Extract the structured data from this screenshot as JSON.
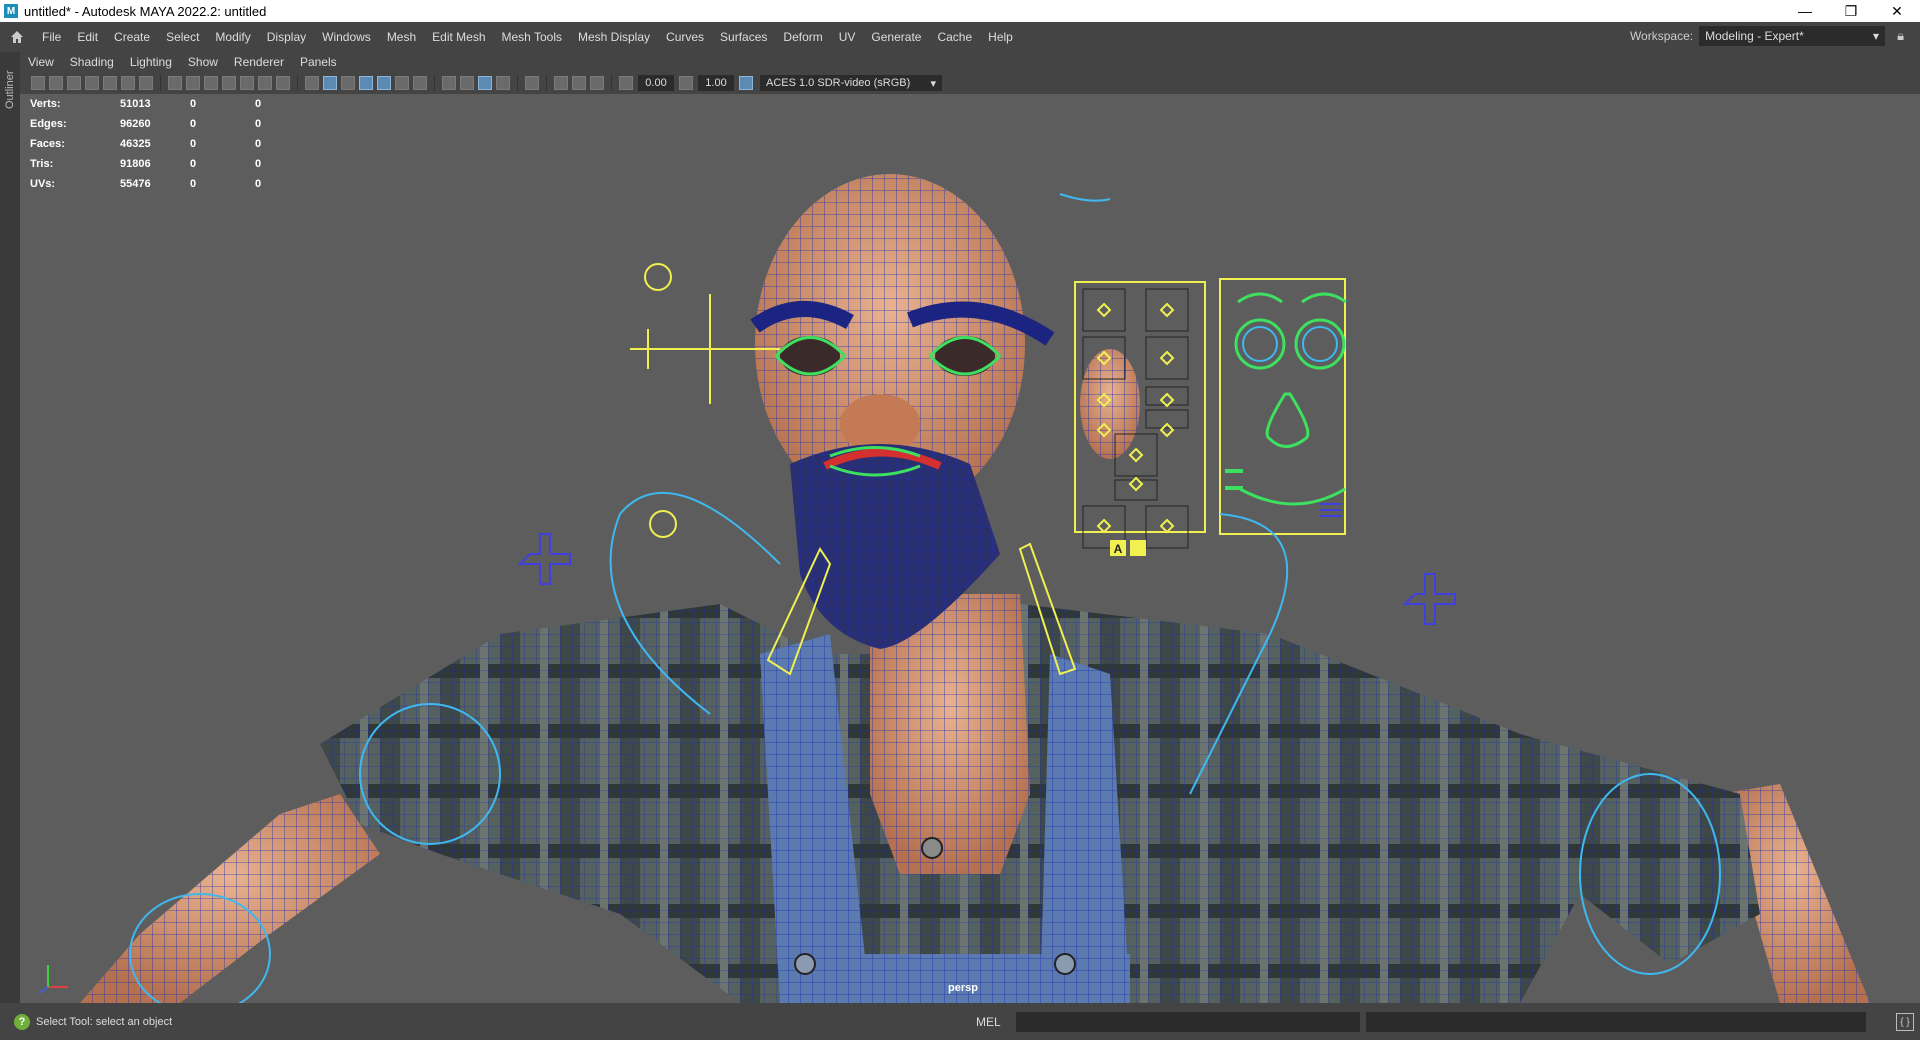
{
  "window": {
    "title": "untitled* - Autodesk MAYA 2022.2: untitled",
    "app_icon_letter": "M",
    "minimize": "—",
    "restore": "❐",
    "close": "✕"
  },
  "menubar": {
    "items": [
      "File",
      "Edit",
      "Create",
      "Select",
      "Modify",
      "Display",
      "Windows",
      "Mesh",
      "Edit Mesh",
      "Mesh Tools",
      "Mesh Display",
      "Curves",
      "Surfaces",
      "Deform",
      "UV",
      "Generate",
      "Cache",
      "Help"
    ],
    "workspace_label": "Workspace:",
    "workspace_value": "Modeling - Expert*"
  },
  "left_strip": {
    "tab_label": "Outliner"
  },
  "panel_menu": {
    "items": [
      "View",
      "Shading",
      "Lighting",
      "Show",
      "Renderer",
      "Panels"
    ]
  },
  "panel_toolbar": {
    "field_1": "0.00",
    "field_2": "1.00",
    "color_space": "ACES 1.0 SDR-video (sRGB)"
  },
  "hud": {
    "rows": [
      {
        "label": "Verts:",
        "v1": "51013",
        "v2": "0",
        "v3": "0"
      },
      {
        "label": "Edges:",
        "v1": "96260",
        "v2": "0",
        "v3": "0"
      },
      {
        "label": "Faces:",
        "v1": "46325",
        "v2": "0",
        "v3": "0"
      },
      {
        "label": "Tris:",
        "v1": "91806",
        "v2": "0",
        "v3": "0"
      },
      {
        "label": "UVs:",
        "v1": "55476",
        "v2": "0",
        "v3": "0"
      }
    ]
  },
  "viewport": {
    "camera_label": "persp",
    "face_panel_letter": "A",
    "colors": {
      "background": "#5d5d5d",
      "skin": "#d9a07a",
      "wire": "#1f2fb0",
      "ctrl_yellow": "#f0f050",
      "ctrl_green": "#3ee060",
      "ctrl_cyan": "#3fb8f0",
      "ctrl_blue": "#4040e0",
      "shirt": "#4d5a5a",
      "overalls": "#5a7ab0"
    }
  },
  "status": {
    "help_text": "Select Tool: select an object",
    "mel_label": "MEL"
  }
}
